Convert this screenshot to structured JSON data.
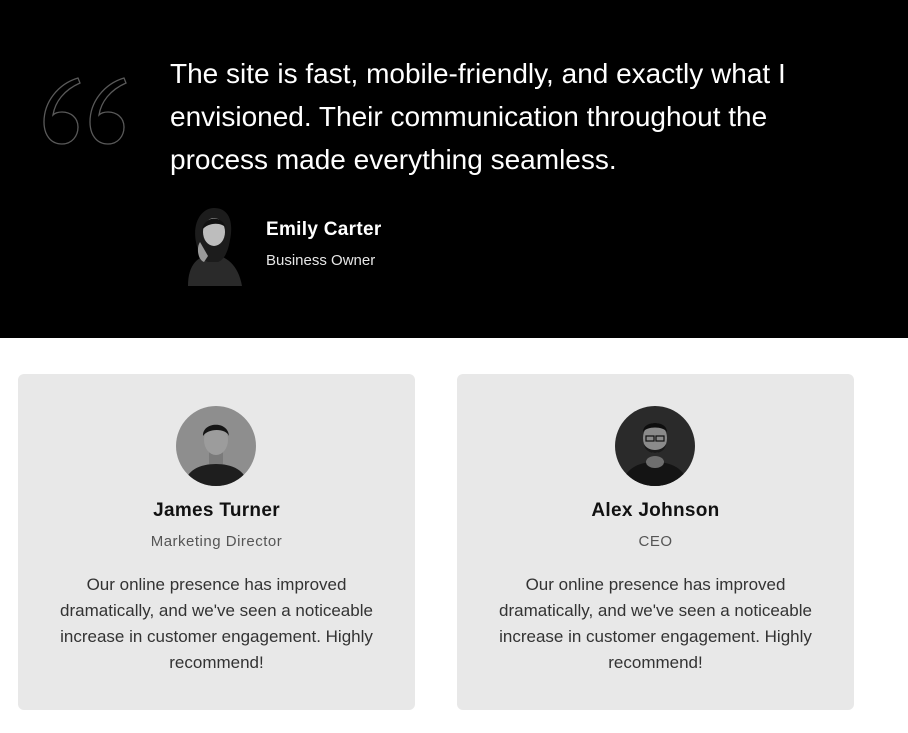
{
  "featured": {
    "quote": "The site is fast, mobile-friendly, and exactly what I envisioned. Their communication throughout the process made everything seamless.",
    "name": "Emily Carter",
    "role": "Business Owner"
  },
  "cards": [
    {
      "name": "James Turner",
      "role": "Marketing Director",
      "text": "Our online presence has improved dramatically, and we've seen a noticeable increase in customer engagement. Highly recommend!"
    },
    {
      "name": "Alex Johnson",
      "role": "CEO",
      "text": "Our online presence has improved dramatically, and we've seen a noticeable increase in customer engagement. Highly recommend!"
    }
  ],
  "colors": {
    "hero_bg": "#000000",
    "card_bg": "#e8e8e8"
  },
  "icons": [
    "quote-icon"
  ]
}
